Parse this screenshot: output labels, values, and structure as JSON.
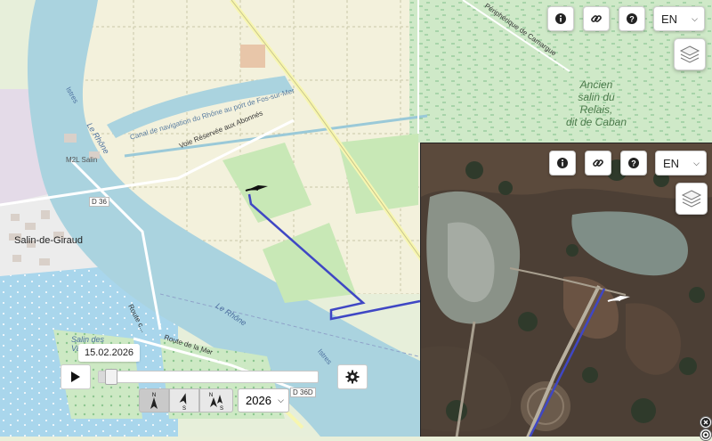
{
  "top_controls": {
    "info_icon": "info-icon",
    "link_icon": "link-icon",
    "help_icon": "help-icon",
    "language": "EN",
    "layers_icon": "layers-icon"
  },
  "inset_controls": {
    "language": "EN"
  },
  "map_labels": {
    "canal_road": "Voie Réservée aux Abonnés",
    "canal": "Canal de navigation du Rhône au port de Fos-sur-Mer",
    "river_north": "Le Rhône",
    "river_south": "Le Rhône",
    "istres_north": "Istres",
    "istres_south": "Istres",
    "camargue_road": "Périphérique de Camargue",
    "salin_name_1": "Ancien",
    "salin_name_2": "salin du",
    "salin_name_3": "Relais,",
    "salin_name_4": "dit de Caban",
    "town": "Salin-de-Giraud",
    "district": "M2L Salin",
    "road_d36": "D 36",
    "road_d36d": "D 36D",
    "route_de_la_mer": "Route de la Mer",
    "route_c": "Route c...",
    "salin_des_1": "Salin des",
    "salin_des_2": "Va"
  },
  "timeline": {
    "date": "15.02.2026",
    "position": 0.03,
    "year": "2026",
    "orientation": {
      "north_label": "N",
      "south_label": "S"
    }
  },
  "colors": {
    "water": "#aad3df",
    "track": "#3f47c4",
    "farmland": "#f2efd8",
    "salt_marsh": "#d3eccb"
  }
}
